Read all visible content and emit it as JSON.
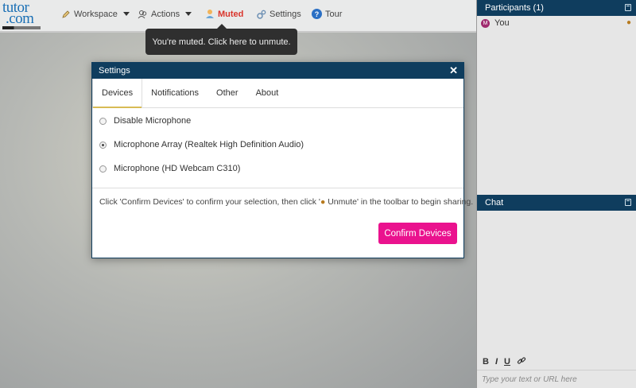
{
  "logo": {
    "line1": "tutor",
    "line2": ".com"
  },
  "toolbar": {
    "workspace_label": "Workspace",
    "actions_label": "Actions",
    "muted_label": "Muted",
    "settings_label": "Settings",
    "tour_label": "Tour"
  },
  "tooltip": {
    "text": "You're muted. Click here to unmute."
  },
  "participants": {
    "title": "Participants (1)",
    "items": [
      {
        "initial": "M",
        "name": "You"
      }
    ]
  },
  "chat": {
    "title": "Chat",
    "tools": {
      "bold": "B",
      "italic": "I",
      "underline": "U"
    },
    "placeholder": "Type your text or URL here"
  },
  "settings_dialog": {
    "title": "Settings",
    "tabs": [
      {
        "label": "Devices",
        "active": true
      },
      {
        "label": "Notifications",
        "active": false
      },
      {
        "label": "Other",
        "active": false
      },
      {
        "label": "About",
        "active": false
      }
    ],
    "options": [
      {
        "label": "Disable Microphone",
        "selected": false
      },
      {
        "label": "Microphone Array (Realtek High Definition Audio)",
        "selected": true
      },
      {
        "label": "Microphone (HD Webcam C310)",
        "selected": false
      }
    ],
    "hint_before": "Click 'Confirm Devices' to confirm your selection, then click '",
    "hint_button": "Unmute",
    "hint_after": "' in the toolbar to begin sharing.",
    "confirm_label": "Confirm Devices"
  },
  "colors": {
    "header_bg": "#0f3d5e",
    "confirm_bg": "#ea128e",
    "muted_text": "#d9342b"
  }
}
